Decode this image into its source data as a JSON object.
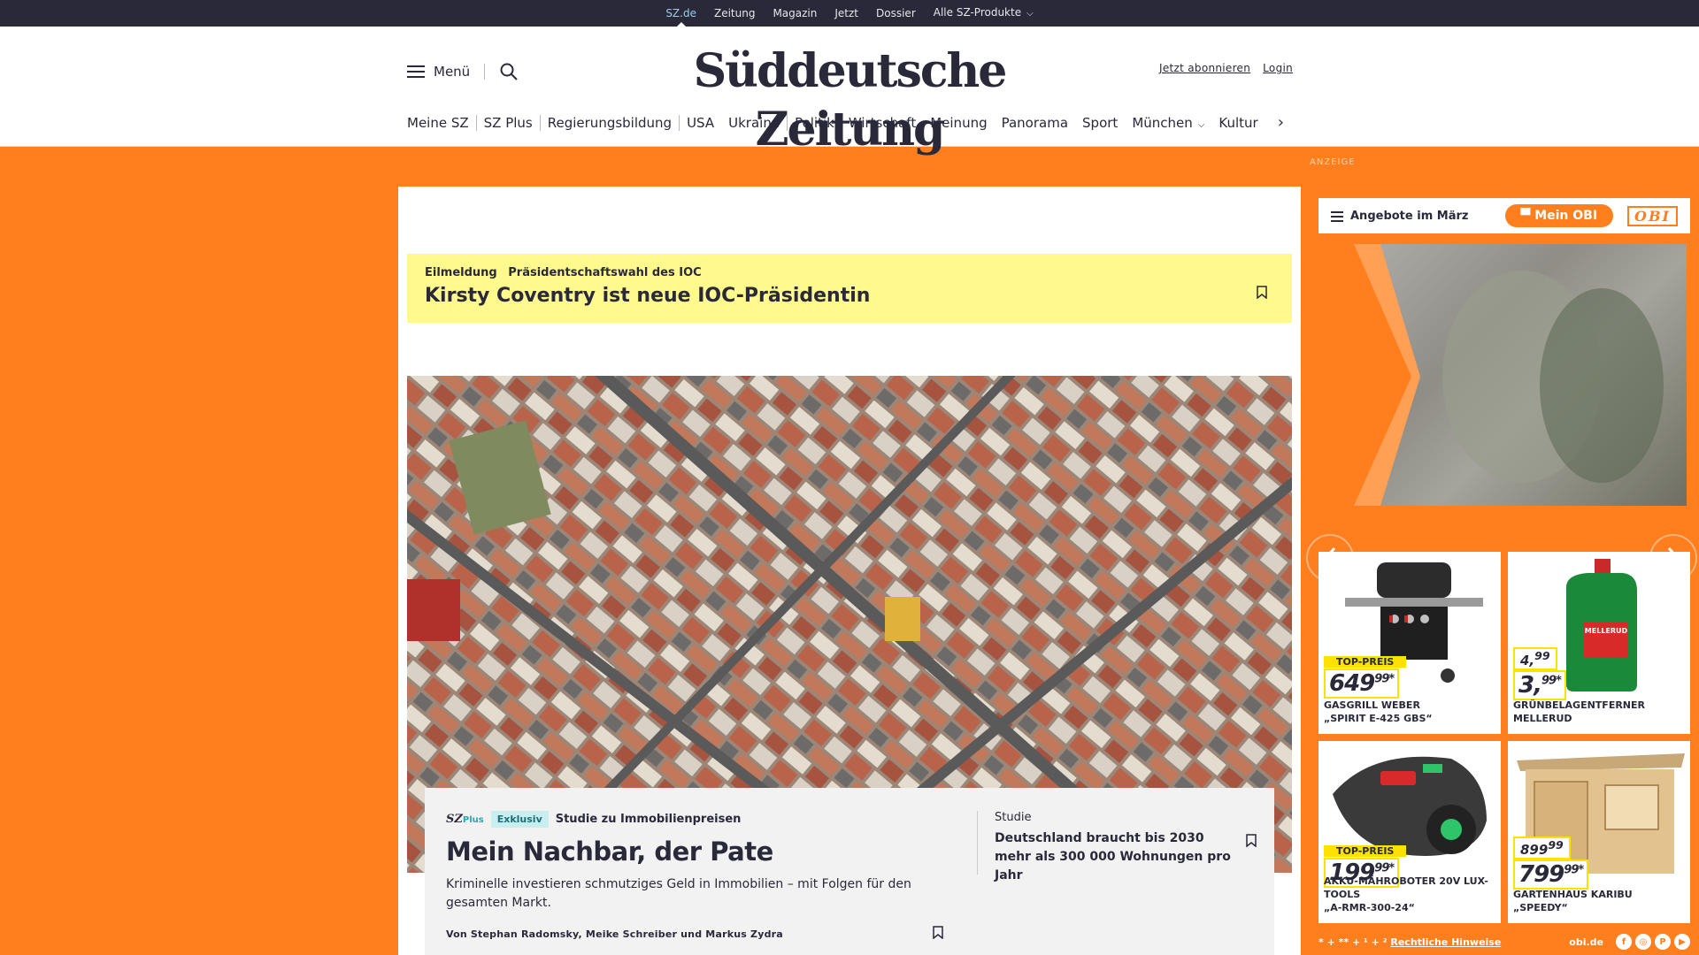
{
  "topbar": {
    "links": [
      "SZ.de",
      "Zeitung",
      "Magazin",
      "Jetzt",
      "Dossier",
      "Alle SZ-Produkte"
    ]
  },
  "header": {
    "menu_label": "Menü",
    "logo": "Süddeutsche Zeitung",
    "subscribe": "Jetzt abonnieren",
    "login": "Login"
  },
  "nav": {
    "items": [
      "Meine SZ",
      "SZ Plus",
      "Regierungsbildung",
      "USA",
      "Ukraine",
      "Politik",
      "Wirtschaft",
      "Meinung",
      "Panorama",
      "Sport",
      "München",
      "Kultur"
    ]
  },
  "breaking": {
    "label": "Eilmeldung",
    "topic": "Präsidentschaftswahl des IOC",
    "headline": "Kirsty Coventry ist neue IOC-Präsidentin"
  },
  "lead": {
    "brand_sz": "SZ",
    "brand_plus": "Plus",
    "badge": "Exklusiv",
    "topic": "Studie zu Immobilienpreisen",
    "headline": "Mein Nachbar, der Pate",
    "teaser": "Kriminelle investieren schmutziges Geld in Immobilien – mit Folgen für den gesamten Markt.",
    "byline": "Von Stephan Radomsky, Meike Schreiber und Markus Zydra",
    "side_kicker": "Studie",
    "side_headline": "Deutschland braucht bis 2030 mehr als 300 000 Wohnungen pro Jahr"
  },
  "ad": {
    "label": "ANZEIGE",
    "offers_label": "Angebote im März",
    "mein_obi": "Mein OBI",
    "logo": "OBI",
    "products": [
      {
        "badge": "TOP-PREIS",
        "price_main": "649",
        "price_cents": "99",
        "price_sup": "*",
        "old_main": "",
        "old_cents": "",
        "name1": "GASGRILL WEBER",
        "name2": "„SPIRIT E-425 GBS“"
      },
      {
        "badge": "",
        "price_main": "3,",
        "price_cents": "99",
        "price_sup": "*",
        "old_main": "4,",
        "old_cents": "99",
        "name1": "GRÜNBELAGENTFERNER",
        "name2": "MELLERUD"
      },
      {
        "badge": "TOP-PREIS",
        "price_main": "199",
        "price_cents": "99",
        "price_sup": "*",
        "old_main": "",
        "old_cents": "",
        "name1": "AKKU-MÄHROBOTER 20V LUX-TOOLS",
        "name2": "„A-RMR-300-24“"
      },
      {
        "badge": "",
        "price_main": "799",
        "price_cents": "99",
        "price_sup": "*",
        "old_main": "899",
        "old_cents": "99",
        "name1": "GARTENHAUS KARIBU „SPEEDY“",
        "name2": ""
      }
    ],
    "footer_notes": "* + ** + ¹ + ²",
    "footer_link": "Rechtliche Hinweise",
    "footer_domain": "obi.de",
    "social": [
      "f",
      "◎",
      "P",
      "▶"
    ],
    "product_label": "MELLERUD"
  },
  "colors": {
    "accent": "#ff7f1f",
    "topbar": "#29293a",
    "breaking": "#fff98e",
    "sz_plus": "#29a7b4"
  }
}
